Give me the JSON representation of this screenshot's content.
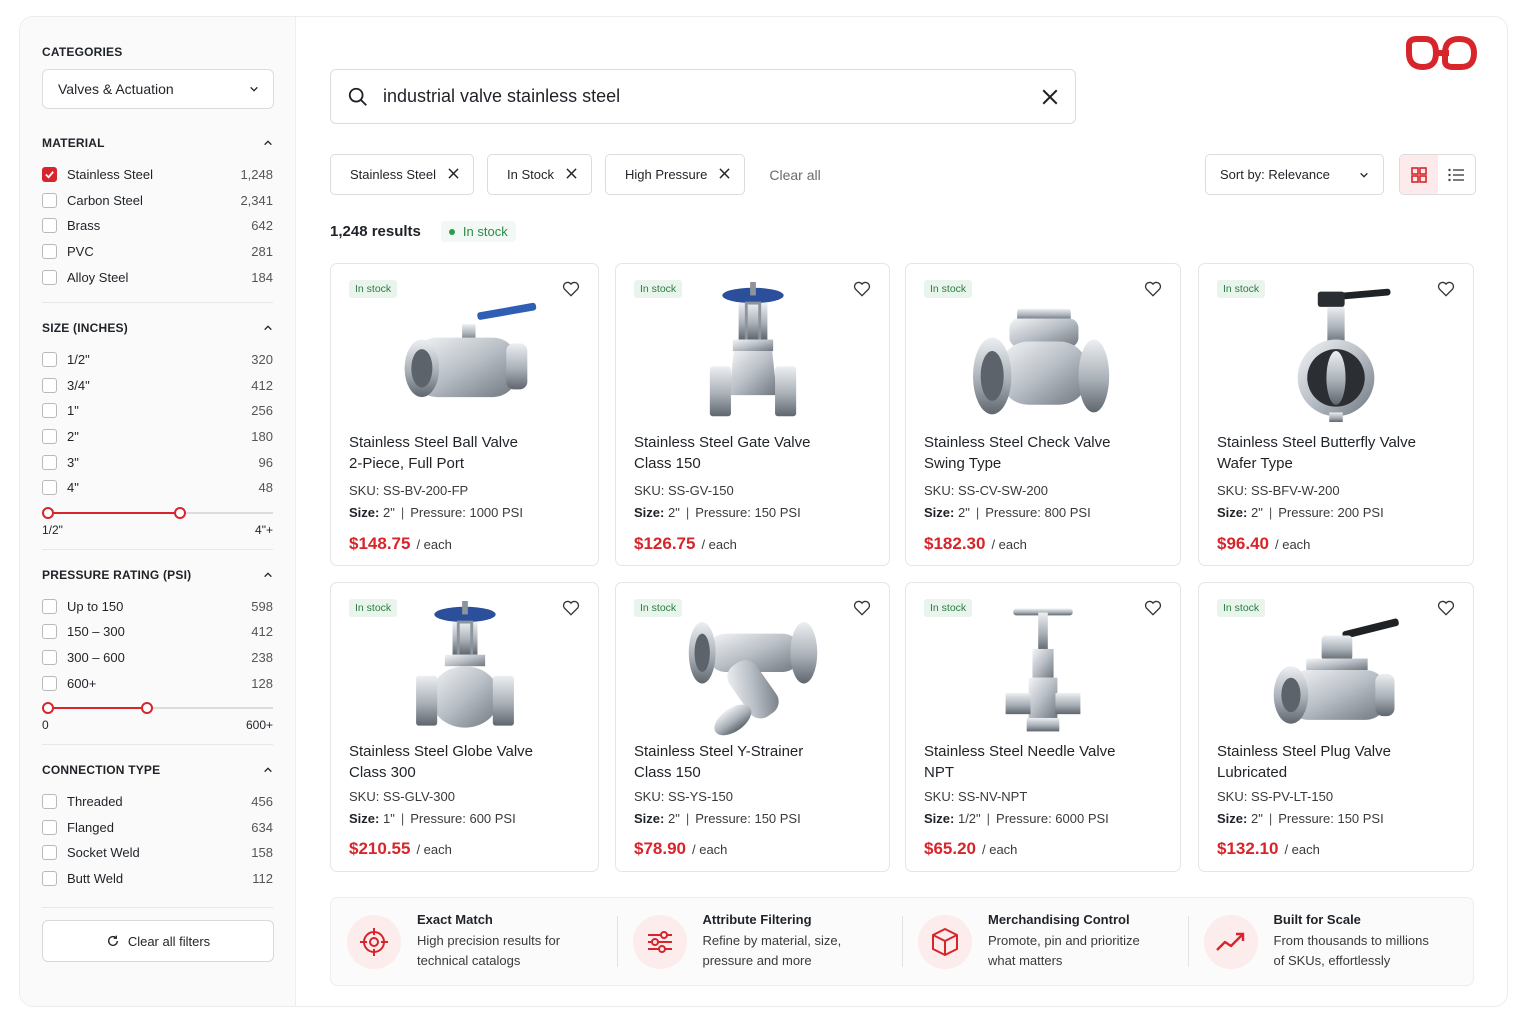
{
  "sidebar": {
    "categories_title": "CATEGORIES",
    "category_selected": "Valves & Actuation",
    "material": {
      "title": "MATERIAL",
      "options": [
        {
          "label": "Stainless Steel",
          "count": "1,248",
          "checked": true
        },
        {
          "label": "Carbon Steel",
          "count": "2,341",
          "checked": false
        },
        {
          "label": "Brass",
          "count": "642",
          "checked": false
        },
        {
          "label": "PVC",
          "count": "281",
          "checked": false
        },
        {
          "label": "Alloy Steel",
          "count": "184",
          "checked": false
        }
      ]
    },
    "size": {
      "title": "SIZE (INCHES)",
      "options": [
        {
          "label": "1/2\"",
          "count": "320"
        },
        {
          "label": "3/4\"",
          "count": "412"
        },
        {
          "label": "1\"",
          "count": "256"
        },
        {
          "label": "2\"",
          "count": "180"
        },
        {
          "label": "3\"",
          "count": "96"
        },
        {
          "label": "4\"",
          "count": "48"
        }
      ],
      "range_min_label": "1/2\"",
      "range_max_label": "4\"+",
      "range_low": 0,
      "range_high": 0.6
    },
    "pressure": {
      "title": "PRESSURE RATING (PSI)",
      "options": [
        {
          "label": "Up to 150",
          "count": "598"
        },
        {
          "label": "150 – 300",
          "count": "412"
        },
        {
          "label": "300 – 600",
          "count": "238"
        },
        {
          "label": "600+",
          "count": "128"
        }
      ],
      "range_min_label": "0",
      "range_max_label": "600+",
      "range_low": 0,
      "range_high": 0.45
    },
    "connection": {
      "title": "CONNECTION TYPE",
      "options": [
        {
          "label": "Threaded",
          "count": "456"
        },
        {
          "label": "Flanged",
          "count": "634"
        },
        {
          "label": "Socket Weld",
          "count": "158"
        },
        {
          "label": "Butt Weld",
          "count": "112"
        }
      ]
    },
    "clear_filters_label": "Clear all filters"
  },
  "search": {
    "query": "industrial valve stainless steel"
  },
  "chips": [
    {
      "label": "Stainless Steel"
    },
    {
      "label": "In Stock"
    },
    {
      "label": "High Pressure"
    }
  ],
  "clear_all_label": "Clear all",
  "sort_label": "Sort by: Relevance",
  "results": {
    "count": "1,248 results",
    "stock_label": "In stock"
  },
  "products": [
    {
      "badge": "In stock",
      "title1": "Stainless Steel Ball Valve",
      "title2": "2-Piece, Full Port",
      "sku": "SKU: SS-BV-200-FP",
      "size_label": "Size:",
      "size": "2\"",
      "pressure": "Pressure: 1000 PSI",
      "price": "$148.75",
      "unit": "/ each",
      "type": "ball"
    },
    {
      "badge": "In stock",
      "title1": "Stainless Steel Gate Valve",
      "title2": "Class 150",
      "sku": "SKU: SS-GV-150",
      "size_label": "Size:",
      "size": "2\"",
      "pressure": "Pressure: 150 PSI",
      "price": "$126.75",
      "unit": "/ each",
      "type": "gate"
    },
    {
      "badge": "In stock",
      "title1": "Stainless Steel Check Valve",
      "title2": "Swing Type",
      "sku": "SKU: SS-CV-SW-200",
      "size_label": "Size:",
      "size": "2\"",
      "pressure": "Pressure: 800 PSI",
      "price": "$182.30",
      "unit": "/ each",
      "type": "check"
    },
    {
      "badge": "In stock",
      "title1": "Stainless Steel Butterfly Valve",
      "title2": "Wafer Type",
      "sku": "SKU: SS-BFV-W-200",
      "size_label": "Size:",
      "size": "2\"",
      "pressure": "Pressure: 200 PSI",
      "price": "$96.40",
      "unit": "/ each",
      "type": "butterfly"
    },
    {
      "badge": "In stock",
      "title1": "Stainless Steel Globe Valve",
      "title2": "Class 300",
      "sku": "SKU: SS-GLV-300",
      "size_label": "Size:",
      "size": "1\"",
      "pressure": "Pressure: 600 PSI",
      "price": "$210.55",
      "unit": "/ each",
      "type": "globe"
    },
    {
      "badge": "In stock",
      "title1": "Stainless Steel Y-Strainer",
      "title2": "Class 150",
      "sku": "SKU: SS-YS-150",
      "size_label": "Size:",
      "size": "2\"",
      "pressure": "Pressure: 150 PSI",
      "price": "$78.90",
      "unit": "/ each",
      "type": "strainer"
    },
    {
      "badge": "In stock",
      "title1": "Stainless Steel Needle Valve",
      "title2": "NPT",
      "sku": "SKU: SS-NV-NPT",
      "size_label": "Size:",
      "size": "1/2\"",
      "pressure": "Pressure: 6000 PSI",
      "price": "$65.20",
      "unit": "/ each",
      "type": "needle"
    },
    {
      "badge": "In stock",
      "title1": "Stainless Steel Plug Valve",
      "title2": "Lubricated",
      "sku": "SKU: SS-PV-LT-150",
      "size_label": "Size:",
      "size": "2\"",
      "pressure": "Pressure: 150 PSI",
      "price": "$132.10",
      "unit": "/ each",
      "type": "plug"
    }
  ],
  "features": [
    {
      "title": "Exact Match",
      "desc": "High precision results for technical catalogs",
      "icon": "target-icon"
    },
    {
      "title": "Attribute Filtering",
      "desc": "Refine by material, size, pressure and more",
      "icon": "sliders-icon"
    },
    {
      "title": "Merchandising Control",
      "desc": "Promote, pin and prioritize what matters",
      "icon": "cube-icon"
    },
    {
      "title": "Built for Scale",
      "desc": "From thousands to millions of SKUs, effortlessly",
      "icon": "trend-up-icon"
    }
  ],
  "colors": {
    "accent": "#d8242b",
    "stock_green": "#2c8a4a"
  }
}
